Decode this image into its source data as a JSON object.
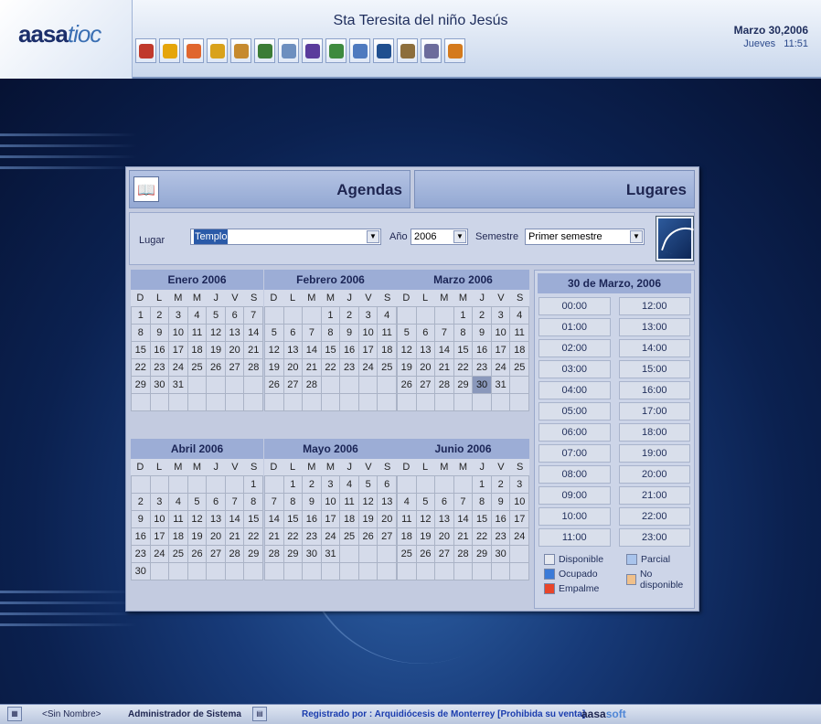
{
  "header": {
    "logo_main": "aasa",
    "logo_accent": "tioc",
    "app_title": "Sta Teresita del niño Jesús",
    "date": "Marzo 30,2006",
    "day_time": "Jueves   11:51",
    "toolbar_icons": [
      "church-icon",
      "balloon-icon",
      "candle-icon",
      "chalice-icon",
      "handshake-icon",
      "rings-icon",
      "book-icon",
      "chart-icon",
      "people-icon",
      "folder-icon",
      "books-icon",
      "gears-icon",
      "document-settings-icon",
      "exit-door-icon"
    ],
    "toolbar_colors": [
      "#c0392b",
      "#e5a50a",
      "#e0662d",
      "#d9a21b",
      "#c68a2e",
      "#3b7c35",
      "#6d8fbf",
      "#5a3c9c",
      "#3e8a3e",
      "#4e7abf",
      "#1f4f8f",
      "#8c6e3c",
      "#6c6c9c",
      "#d47a1c"
    ]
  },
  "panel": {
    "agendas_label": "Agendas",
    "lugares_label": "Lugares",
    "filter": {
      "lugar_label": "Lugar",
      "lugar_value": "Templo",
      "anio_label": "Año",
      "anio_value": "2006",
      "semestre_label": "Semestre",
      "semestre_value": "Primer semestre"
    },
    "weekday_headers": [
      "D",
      "L",
      "M",
      "M",
      "J",
      "V",
      "S"
    ],
    "calendars": [
      {
        "title": "Enero 2006",
        "start": 0,
        "days": 31
      },
      {
        "title": "Febrero 2006",
        "start": 3,
        "days": 28
      },
      {
        "title": "Marzo 2006",
        "start": 3,
        "days": 31,
        "today": 30
      },
      {
        "title": "Abril 2006",
        "start": 6,
        "days": 30
      },
      {
        "title": "Mayo 2006",
        "start": 1,
        "days": 31
      },
      {
        "title": "Junio 2006",
        "start": 4,
        "days": 30
      }
    ],
    "day_schedule": {
      "title": "30 de Marzo, 2006",
      "slots_am": [
        "00:00",
        "01:00",
        "02:00",
        "03:00",
        "04:00",
        "05:00",
        "06:00",
        "07:00",
        "08:00",
        "09:00",
        "10:00",
        "11:00"
      ],
      "slots_pm": [
        "12:00",
        "13:00",
        "14:00",
        "15:00",
        "16:00",
        "17:00",
        "18:00",
        "19:00",
        "20:00",
        "21:00",
        "22:00",
        "23:00"
      ]
    },
    "legend": [
      {
        "label": "Disponible",
        "color": "#e6e9f0"
      },
      {
        "label": "Parcial",
        "color": "#a9c4ec"
      },
      {
        "label": "Ocupado",
        "color": "#3a7ad8"
      },
      {
        "label": "No disponible",
        "color": "#f0c08a"
      },
      {
        "label": "Empalme",
        "color": "#e8452a"
      }
    ]
  },
  "status_bar": {
    "user_name": "<Sin Nombre>",
    "role": "Administrador de Sistema",
    "registered": "Registrado por : Arquidiócesis de Monterrey  [Prohibida su venta]",
    "brand_main": "aasa",
    "brand_accent": "soft"
  }
}
